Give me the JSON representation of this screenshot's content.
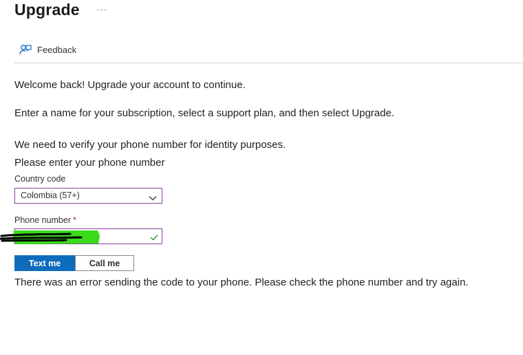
{
  "header": {
    "title": "Upgrade",
    "more_label": "···"
  },
  "toolbar": {
    "feedback_label": "Feedback",
    "feedback_icon": "feedback-icon"
  },
  "main": {
    "welcome_text": "Welcome back! Upgrade your account to continue.",
    "instructions_text": "Enter a name for your subscription, select a support plan, and then select Upgrade.",
    "verify_text": "We need to verify your phone number for identity purposes.",
    "enter_phone_text": "Please enter your phone number"
  },
  "form": {
    "country_code_label": "Country code",
    "country_code_value": "Colombia (57+)",
    "phone_label": "Phone number",
    "phone_required_marker": "*",
    "phone_value": "",
    "phone_valid_icon": "checkmark-icon"
  },
  "actions": {
    "text_me_label": "Text me",
    "call_me_label": "Call me"
  },
  "status": {
    "error_text": "There was an error sending the code to your phone. Please check the phone number and try again."
  },
  "colors": {
    "primary": "#0f6cbd",
    "field_border": "#8a3fa0",
    "valid_check": "#107c10",
    "redaction_highlight": "#3adb1a",
    "redaction_scribble": "#000000"
  }
}
